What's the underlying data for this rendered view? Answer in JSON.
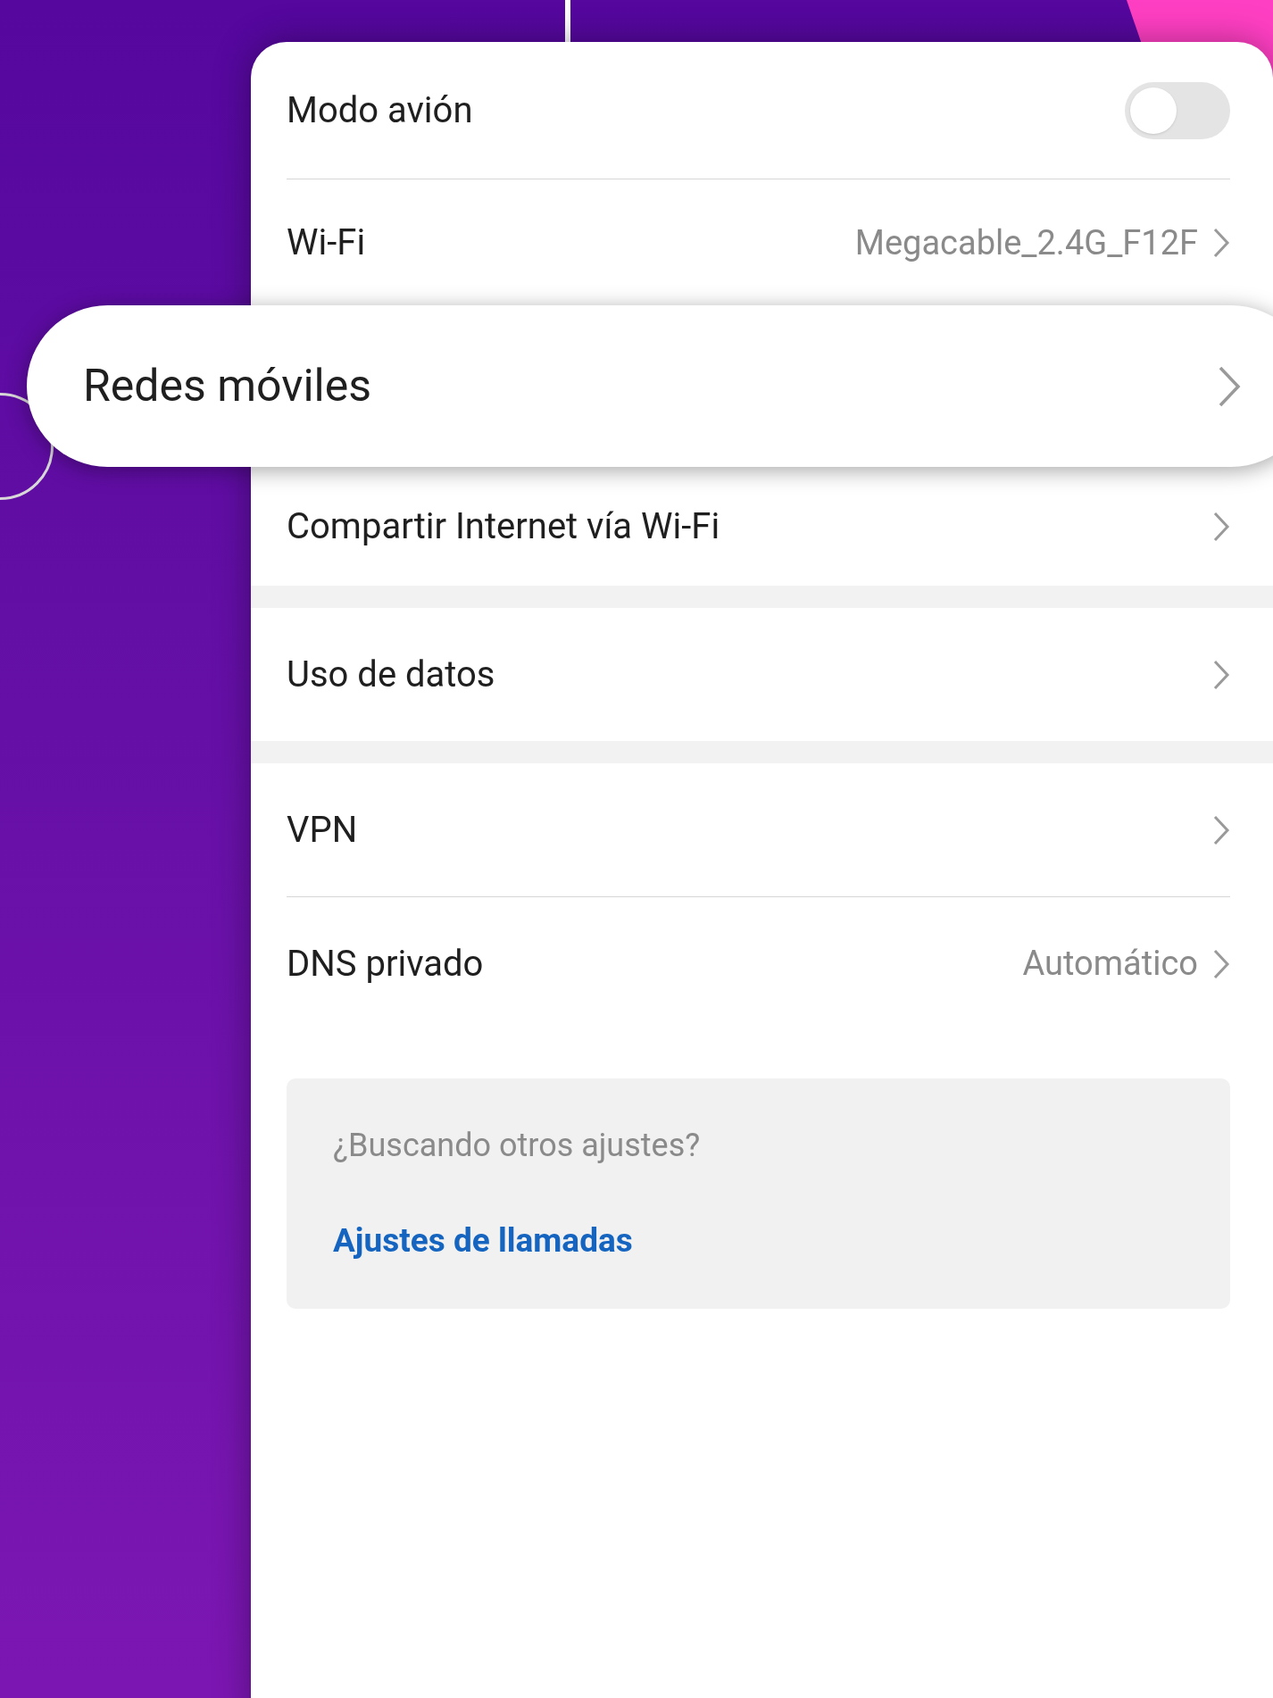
{
  "groups": [
    {
      "items": [
        {
          "kind": "toggle",
          "label": "Modo avión",
          "on": false
        },
        {
          "kind": "link",
          "label": "Wi-Fi",
          "value": "Megacable_2.4G_F12F"
        },
        {
          "kind": "link",
          "label": "Compartir Internet vía Wi-Fi"
        }
      ]
    },
    {
      "items": [
        {
          "kind": "link",
          "label": "Uso de datos"
        }
      ]
    },
    {
      "items": [
        {
          "kind": "link",
          "label": "VPN"
        },
        {
          "kind": "link",
          "label": "DNS privado",
          "value": "Automático"
        }
      ]
    }
  ],
  "callout": {
    "label": "Redes móviles"
  },
  "hint_box": {
    "text": "¿Buscando otros ajustes?",
    "link": "Ajustes de llamadas"
  }
}
